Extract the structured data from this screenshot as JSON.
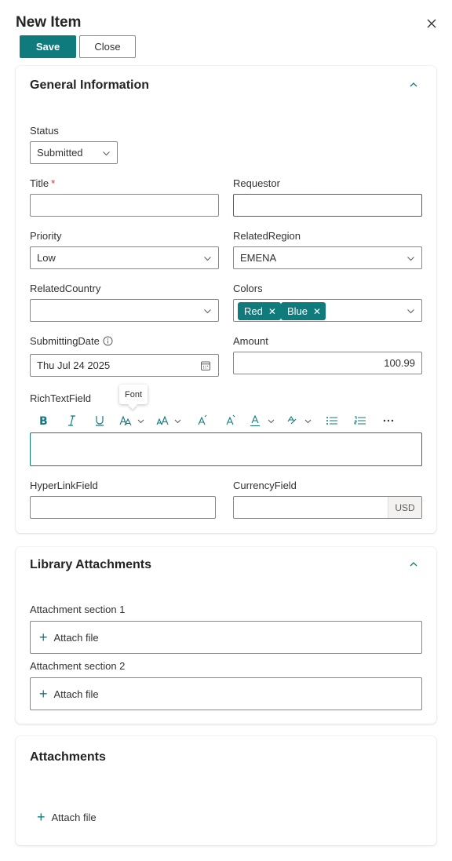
{
  "header": {
    "title": "New Item"
  },
  "toolbar": {
    "save_label": "Save",
    "close_label": "Close"
  },
  "general": {
    "title": "General Information",
    "status": {
      "label": "Status",
      "value": "Submitted"
    },
    "title_field": {
      "label": "Title",
      "required_mark": "*",
      "value": ""
    },
    "requestor": {
      "label": "Requestor",
      "value": ""
    },
    "priority": {
      "label": "Priority",
      "value": "Low"
    },
    "related_region": {
      "label": "RelatedRegion",
      "value": "EMENA"
    },
    "related_country": {
      "label": "RelatedCountry",
      "value": ""
    },
    "colors": {
      "label": "Colors",
      "tags": [
        "Red",
        "Blue"
      ]
    },
    "submitting_date": {
      "label": "SubmittingDate",
      "value": "Thu Jul 24 2025"
    },
    "amount": {
      "label": "Amount",
      "value": "100.99"
    },
    "rich_text": {
      "label": "RichTextField",
      "tooltip": "Font"
    },
    "hyperlink": {
      "label": "HyperLinkField",
      "value": ""
    },
    "currency": {
      "label": "CurrencyField",
      "value": "",
      "unit": "USD"
    }
  },
  "library": {
    "title": "Library Attachments",
    "section1_label": "Attachment section 1",
    "section2_label": "Attachment section 2",
    "attach_label": "Attach file"
  },
  "attachments": {
    "title": "Attachments",
    "attach_label": "Attach file"
  },
  "colors": {
    "accent": "#0f7b7c",
    "required": "#d13438"
  }
}
